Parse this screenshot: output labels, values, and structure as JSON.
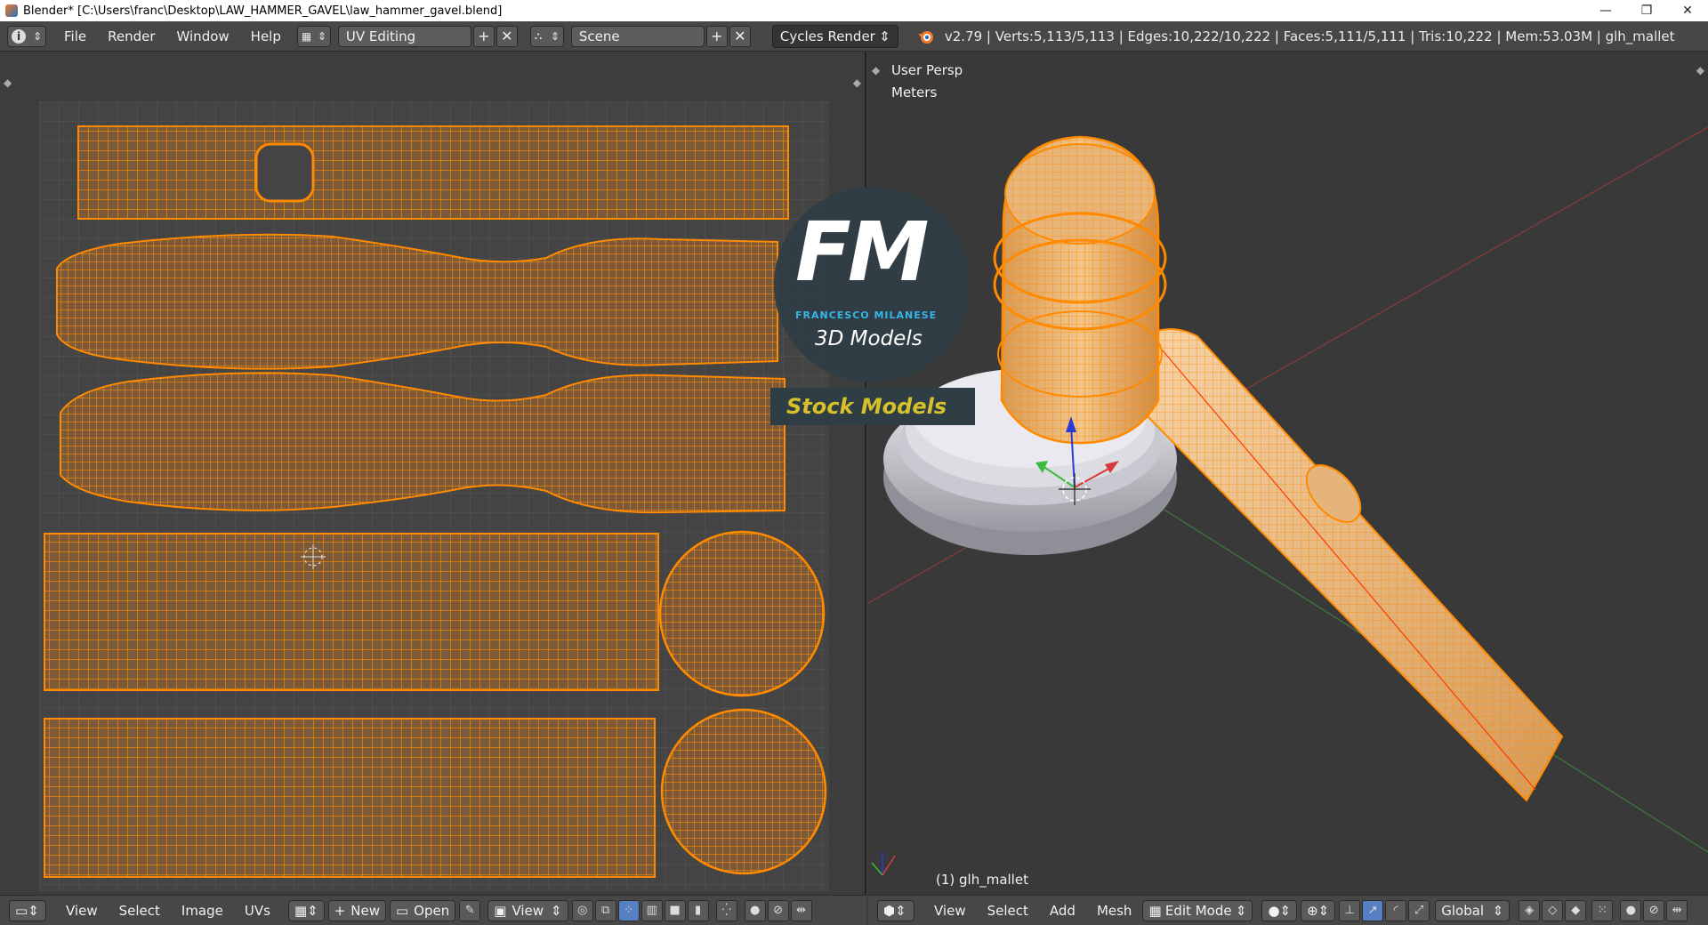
{
  "window": {
    "title": "Blender* [C:\\Users\\franc\\Desktop\\LAW_HAMMER_GAVEL\\law_hammer_gavel.blend]",
    "minimize_glyph": "—",
    "restore_glyph": "❐",
    "close_glyph": "✕"
  },
  "infobar": {
    "menus": [
      "File",
      "Render",
      "Window",
      "Help"
    ],
    "screen_layout": "UV Editing",
    "scene": "Scene",
    "render_engine": "Cycles Render",
    "stats": "v2.79 | Verts:5,113/5,113 | Edges:10,222/10,222 | Faces:5,111/5,111 | Tris:10,222 | Mem:53.03M | glh_mallet"
  },
  "viewport": {
    "view_name": "User Persp",
    "units": "Meters",
    "object_label": "(1) glh_mallet"
  },
  "watermark": {
    "initials": "FM",
    "name": "FRANCESCO MILANESE",
    "subtitle": "3D Models",
    "banner": "Stock Models"
  },
  "uv_bottom": {
    "menus": [
      "View",
      "Select",
      "Image",
      "UVs"
    ],
    "new_label": "New",
    "open_label": "Open",
    "view_label": "View"
  },
  "vp_bottom": {
    "menus": [
      "View",
      "Select",
      "Add",
      "Mesh"
    ],
    "mode": "Edit Mode",
    "orientation": "Global"
  },
  "colors": {
    "wire": "#ff8a00",
    "uv_fill": "#7a5a3a",
    "accent": "#5680c2",
    "banner_text": "#d6c12a"
  },
  "icons": [
    "info-icon",
    "screen-layout-icon",
    "scene-icon",
    "blender-logo-icon",
    "image-editor-icon",
    "view3d-icon",
    "pivot-icon",
    "manipulator-icon"
  ]
}
